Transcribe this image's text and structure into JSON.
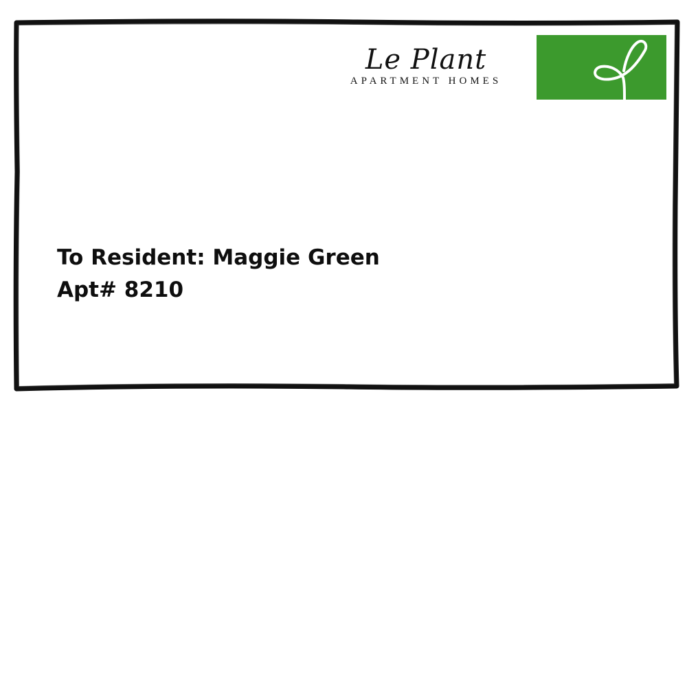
{
  "brand": {
    "name": "Le Plant",
    "tagline": "APARTMENT HOMES"
  },
  "stamp": {
    "icon": "sprout-icon",
    "color": "#3c9a2d"
  },
  "recipient": {
    "line1": "To Resident: Maggie Green",
    "line2": "Apt# 8210"
  }
}
